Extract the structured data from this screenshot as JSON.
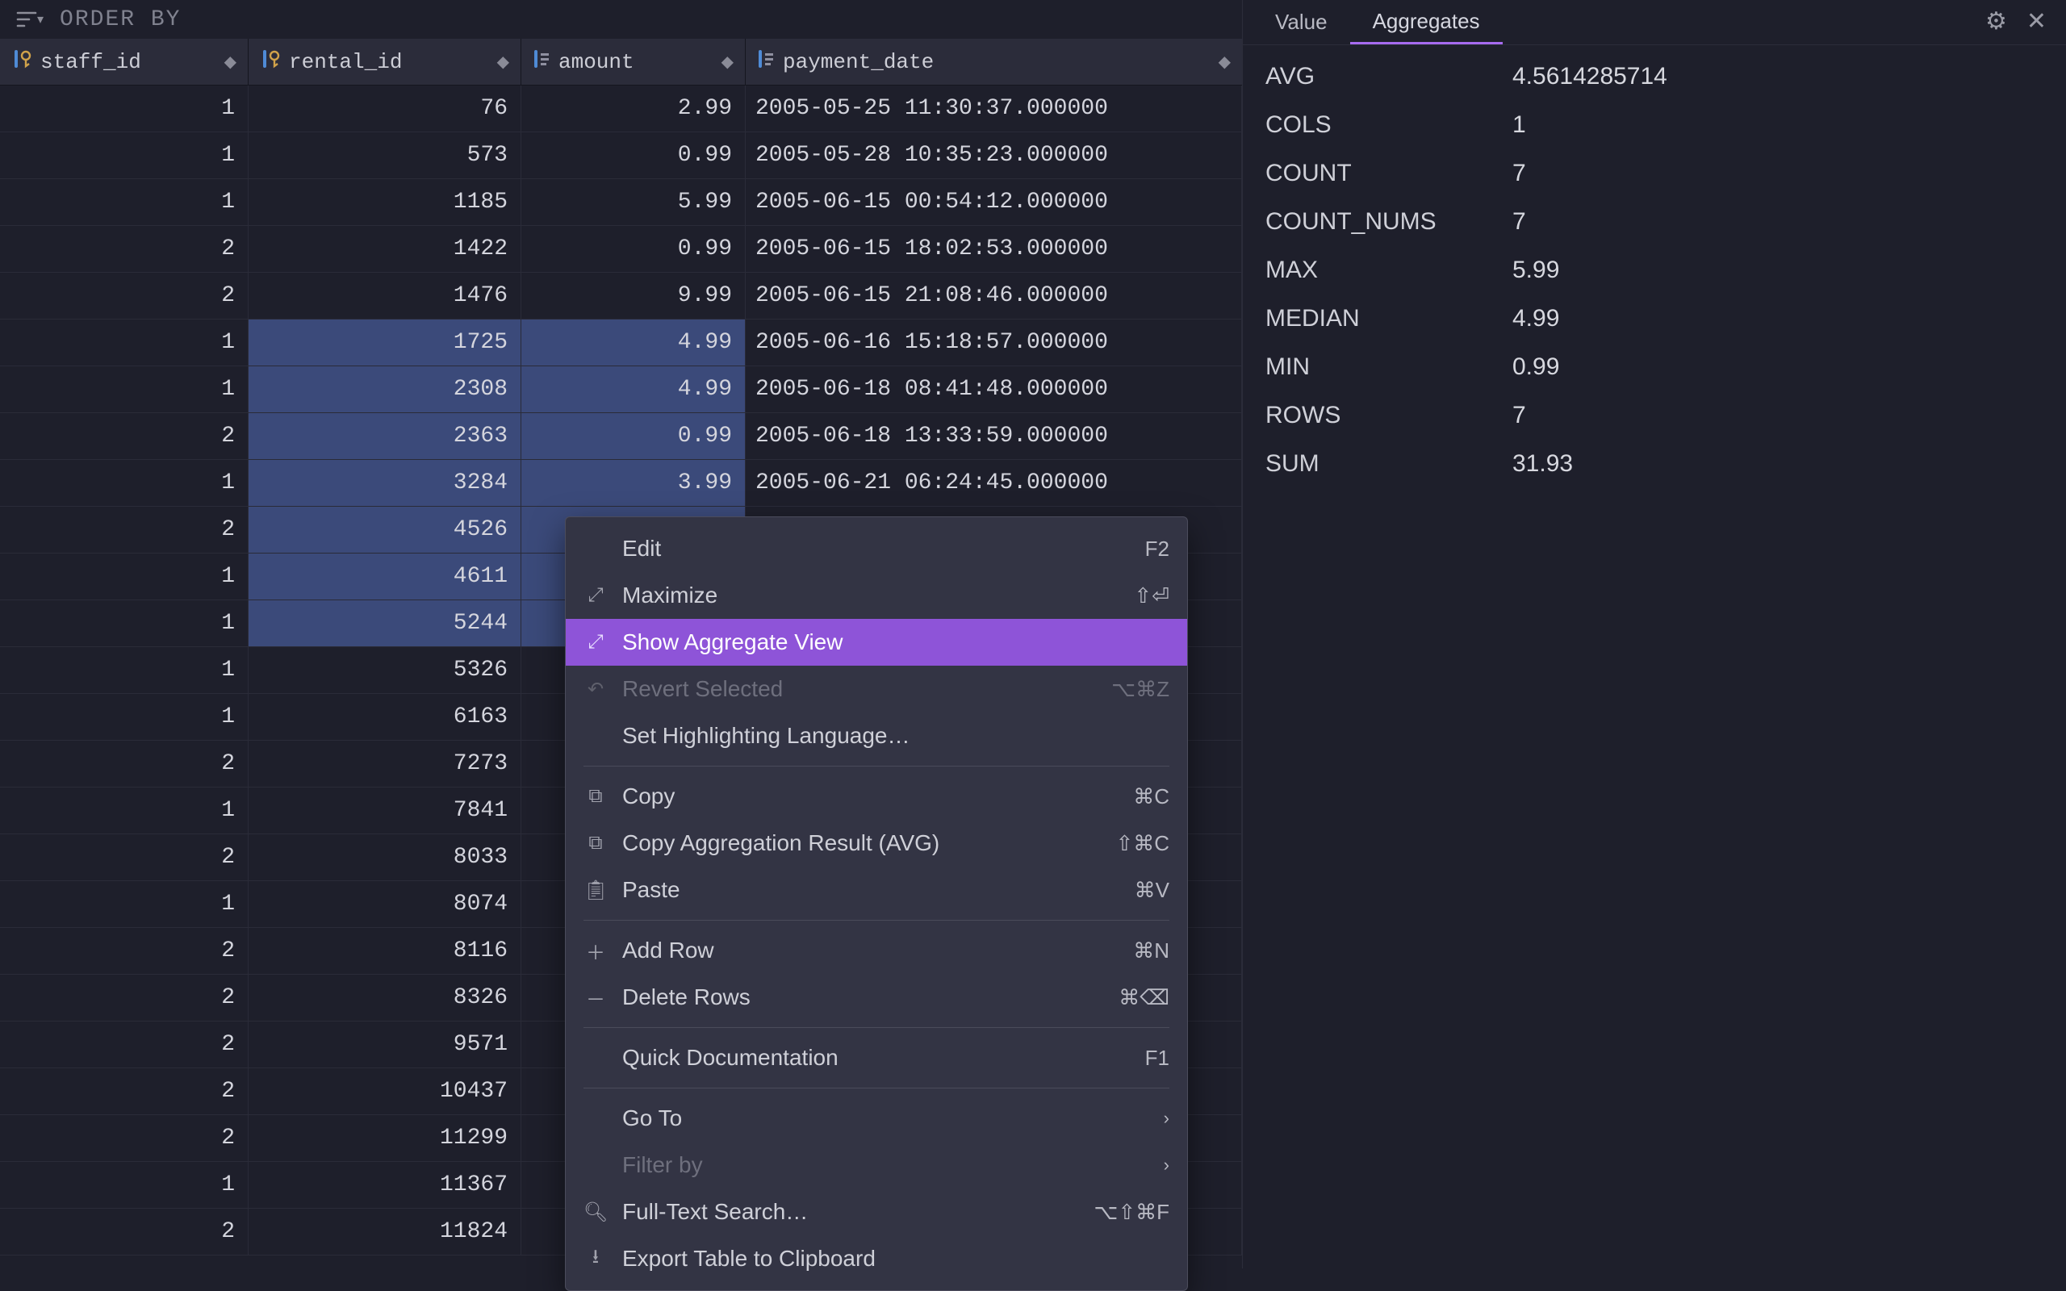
{
  "orderbar": {
    "label": "ORDER BY"
  },
  "columns": {
    "staff": {
      "label": "staff_id"
    },
    "rental": {
      "label": "rental_id"
    },
    "amount": {
      "label": "amount"
    },
    "date": {
      "label": "payment_date"
    }
  },
  "rows": [
    {
      "staff": "1",
      "rental": "76",
      "amount": "2.99",
      "date": "2005-05-25 11:30:37.000000"
    },
    {
      "staff": "1",
      "rental": "573",
      "amount": "0.99",
      "date": "2005-05-28 10:35:23.000000"
    },
    {
      "staff": "1",
      "rental": "1185",
      "amount": "5.99",
      "date": "2005-06-15 00:54:12.000000"
    },
    {
      "staff": "2",
      "rental": "1422",
      "amount": "0.99",
      "date": "2005-06-15 18:02:53.000000"
    },
    {
      "staff": "2",
      "rental": "1476",
      "amount": "9.99",
      "date": "2005-06-15 21:08:46.000000"
    },
    {
      "staff": "1",
      "rental": "1725",
      "amount": "4.99",
      "date": "2005-06-16 15:18:57.000000"
    },
    {
      "staff": "1",
      "rental": "2308",
      "amount": "4.99",
      "date": "2005-06-18 08:41:48.000000"
    },
    {
      "staff": "2",
      "rental": "2363",
      "amount": "0.99",
      "date": "2005-06-18 13:33:59.000000"
    },
    {
      "staff": "1",
      "rental": "3284",
      "amount": "3.99",
      "date": "2005-06-21 06:24:45.000000"
    },
    {
      "staff": "2",
      "rental": "4526",
      "amount": "",
      "date": ""
    },
    {
      "staff": "1",
      "rental": "4611",
      "amount": "",
      "date": ""
    },
    {
      "staff": "1",
      "rental": "5244",
      "amount": "",
      "date": ""
    },
    {
      "staff": "1",
      "rental": "5326",
      "amount": "",
      "date": ""
    },
    {
      "staff": "1",
      "rental": "6163",
      "amount": "",
      "date": ""
    },
    {
      "staff": "2",
      "rental": "7273",
      "amount": "",
      "date": ""
    },
    {
      "staff": "1",
      "rental": "7841",
      "amount": "",
      "date": ""
    },
    {
      "staff": "2",
      "rental": "8033",
      "amount": "",
      "date": ""
    },
    {
      "staff": "1",
      "rental": "8074",
      "amount": "",
      "date": ""
    },
    {
      "staff": "2",
      "rental": "8116",
      "amount": "",
      "date": ""
    },
    {
      "staff": "2",
      "rental": "8326",
      "amount": "",
      "date": ""
    },
    {
      "staff": "2",
      "rental": "9571",
      "amount": "",
      "date": ""
    },
    {
      "staff": "2",
      "rental": "10437",
      "amount": "",
      "date": ""
    },
    {
      "staff": "2",
      "rental": "11299",
      "amount": "",
      "date": ""
    },
    {
      "staff": "1",
      "rental": "11367",
      "amount": "",
      "date": ""
    },
    {
      "staff": "2",
      "rental": "11824",
      "amount": "",
      "date": ""
    }
  ],
  "selected_amount_rows": [
    5,
    6,
    7,
    8,
    9,
    10,
    11
  ],
  "tabs": {
    "value": "Value",
    "aggregates": "Aggregates"
  },
  "aggregates": [
    {
      "k": "AVG",
      "v": "4.5614285714"
    },
    {
      "k": "COLS",
      "v": "1"
    },
    {
      "k": "COUNT",
      "v": "7"
    },
    {
      "k": "COUNT_NUMS",
      "v": "7"
    },
    {
      "k": "MAX",
      "v": "5.99"
    },
    {
      "k": "MEDIAN",
      "v": "4.99"
    },
    {
      "k": "MIN",
      "v": "0.99"
    },
    {
      "k": "ROWS",
      "v": "7"
    },
    {
      "k": "SUM",
      "v": "31.93"
    }
  ],
  "ctx": {
    "edit": {
      "label": "Edit",
      "shortcut": "F2"
    },
    "maximize": {
      "label": "Maximize",
      "shortcut": "⇧⏎"
    },
    "aggregate": {
      "label": "Show Aggregate View",
      "shortcut": ""
    },
    "revert": {
      "label": "Revert Selected",
      "shortcut": "⌥⌘Z"
    },
    "highlight": {
      "label": "Set Highlighting Language…",
      "shortcut": ""
    },
    "copy": {
      "label": "Copy",
      "shortcut": "⌘C"
    },
    "copyagg": {
      "label": "Copy Aggregation Result (AVG)",
      "shortcut": "⇧⌘C"
    },
    "paste": {
      "label": "Paste",
      "shortcut": "⌘V"
    },
    "addrow": {
      "label": "Add Row",
      "shortcut": "⌘N"
    },
    "delrows": {
      "label": "Delete Rows",
      "shortcut": "⌘⌫"
    },
    "quickdoc": {
      "label": "Quick Documentation",
      "shortcut": "F1"
    },
    "goto": {
      "label": "Go To",
      "shortcut": "›"
    },
    "filterby": {
      "label": "Filter by",
      "shortcut": "›"
    },
    "fts": {
      "label": "Full-Text Search…",
      "shortcut": "⌥⇧⌘F"
    },
    "export": {
      "label": "Export Table to Clipboard",
      "shortcut": ""
    }
  }
}
